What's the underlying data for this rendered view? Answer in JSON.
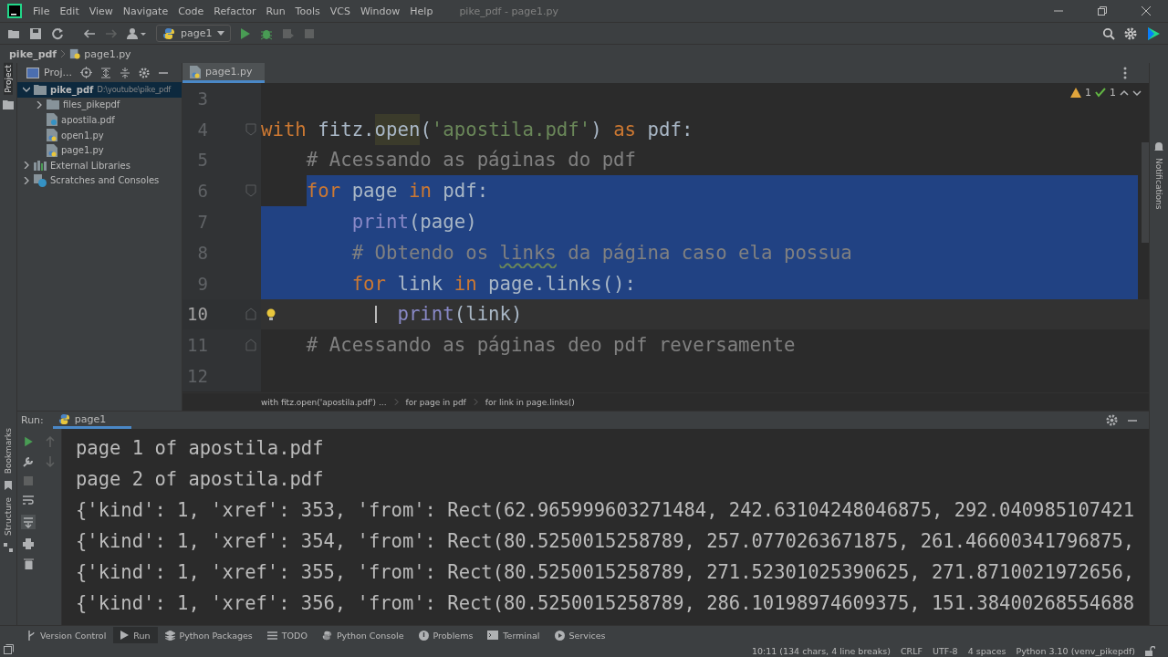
{
  "menu": [
    "File",
    "Edit",
    "View",
    "Navigate",
    "Code",
    "Refactor",
    "Run",
    "Tools",
    "VCS",
    "Window",
    "Help"
  ],
  "window_title": "pike_pdf - page1.py",
  "run_config": "page1",
  "breadcrumbs": [
    "pike_pdf",
    "page1.py"
  ],
  "left_stripe": [
    "Project",
    "Bookmarks",
    "Structure"
  ],
  "right_stripe": "Notifications",
  "project_panel": {
    "title": "Proj...",
    "tree": [
      {
        "label": "pike_pdf",
        "path": "D:\\youtube\\pike_pdf",
        "kind": "folder",
        "expanded": true,
        "selected": true,
        "children": [
          {
            "label": "files_pikepdf",
            "kind": "folder",
            "expanded": false,
            "selected": false
          },
          {
            "label": "apostila.pdf",
            "kind": "pdf",
            "selected": false
          },
          {
            "label": "open1.py",
            "kind": "python",
            "selected": false
          },
          {
            "label": "page1.py",
            "kind": "python",
            "selected": false
          }
        ]
      },
      {
        "label": "External Libraries",
        "kind": "libraries",
        "expanded": false,
        "selected": false
      },
      {
        "label": "Scratches and Consoles",
        "kind": "scratches",
        "expanded": false,
        "selected": false
      }
    ]
  },
  "editor_tabs": [
    {
      "label": "page1.py",
      "selected": true
    }
  ],
  "inspections": {
    "warnings": "1",
    "weak_warnings": "1"
  },
  "code_lines": [
    {
      "number": "3",
      "current": false,
      "selected": false
    },
    {
      "number": "4",
      "current": false,
      "selected": false,
      "fold_start": true,
      "tokens": [
        {
          "t": "with",
          "kind": "keyword"
        },
        {
          "t": " fitz.",
          "kind": "plain"
        },
        {
          "t": "open",
          "kind": "usage"
        },
        {
          "t": "(",
          "kind": "plain"
        },
        {
          "t": "'apostila.pdf'",
          "kind": "string"
        },
        {
          "t": ") ",
          "kind": "plain"
        },
        {
          "t": "as",
          "kind": "keyword"
        },
        {
          "t": " pdf:",
          "kind": "plain"
        }
      ],
      "children": [
        {
          "number": "5",
          "current": false,
          "selected": false,
          "tokens": [
            {
              "t": "# Acessando as páginas do pdf",
              "kind": "comment"
            }
          ]
        },
        {
          "number": "6",
          "current": false,
          "selected": true,
          "fold_start": true,
          "tokens": [
            {
              "t": "for",
              "kind": "keyword"
            },
            {
              "t": " page ",
              "kind": "plain"
            },
            {
              "t": "in",
              "kind": "keyword"
            },
            {
              "t": " pdf:",
              "kind": "plain"
            }
          ],
          "children": [
            {
              "number": "7",
              "current": false,
              "selected": true,
              "tokens": [
                {
                  "t": "print",
                  "kind": "builtin"
                },
                {
                  "t": "(page)",
                  "kind": "plain"
                }
              ]
            },
            {
              "number": "8",
              "current": false,
              "selected": true,
              "tokens": [
                {
                  "t": "# Obtendo os ",
                  "kind": "comment"
                },
                {
                  "t": "links",
                  "kind": "typo"
                },
                {
                  "t": " da página caso ela possua",
                  "kind": "comment"
                }
              ]
            },
            {
              "number": "9",
              "current": false,
              "selected": true,
              "tokens": [
                {
                  "t": "for",
                  "kind": "keyword"
                },
                {
                  "t": " link ",
                  "kind": "plain"
                },
                {
                  "t": "in",
                  "kind": "keyword"
                },
                {
                  "t": " page.links():",
                  "kind": "plain"
                }
              ],
              "children": [
                {
                  "number": "10",
                  "current": true,
                  "selected": false,
                  "fold_end": true,
                  "bulb": true,
                  "caret": true,
                  "tokens": [
                    {
                      "t": "print",
                      "kind": "builtin"
                    },
                    {
                      "t": "(link)",
                      "kind": "plain"
                    }
                  ]
                }
              ]
            }
          ]
        },
        {
          "number": "11",
          "current": false,
          "selected": false,
          "fold_end": true,
          "tokens": [
            {
              "t": "# Acessando as páginas deo pdf reversamente",
              "kind": "comment"
            }
          ]
        }
      ]
    },
    {
      "number": "12",
      "current": false,
      "selected": false
    }
  ],
  "code_breadcrumbs": [
    "with fitz.open('apostila.pdf') ...",
    "for page in pdf",
    "for link in page.links()"
  ],
  "run_panel": {
    "label": "Run:",
    "tabs": [
      {
        "label": "page1",
        "selected": true
      }
    ],
    "output": [
      "page 1 of apostila.pdf",
      "page 2 of apostila.pdf",
      "{'kind': 1, 'xref': 353, 'from': Rect(62.965999603271484, 242.63104248046875, 292.040985107421",
      "{'kind': 1, 'xref': 354, 'from': Rect(80.5250015258789, 257.0770263671875, 261.46600341796875,",
      "{'kind': 1, 'xref': 355, 'from': Rect(80.5250015258789, 271.52301025390625, 271.8710021972656,",
      "{'kind': 1, 'xref': 356, 'from': Rect(80.5250015258789, 286.10198974609375, 151.38400268554688"
    ]
  },
  "tool_windows": [
    {
      "label": "Version Control",
      "kind": "vcs",
      "selected": false
    },
    {
      "label": "Run",
      "kind": "run",
      "selected": true
    },
    {
      "label": "Python Packages",
      "kind": "packages",
      "selected": false
    },
    {
      "label": "TODO",
      "kind": "todo",
      "selected": false
    },
    {
      "label": "Python Console",
      "kind": "console",
      "selected": false
    },
    {
      "label": "Problems",
      "kind": "problems",
      "selected": false
    },
    {
      "label": "Terminal",
      "kind": "terminal",
      "selected": false
    },
    {
      "label": "Services",
      "kind": "services",
      "selected": false
    }
  ],
  "status": [
    "10:11 (134 chars, 4 line breaks)",
    "CRLF",
    "UTF-8",
    "4 spaces",
    "Python 3.10 (venv_pikepdf)"
  ]
}
